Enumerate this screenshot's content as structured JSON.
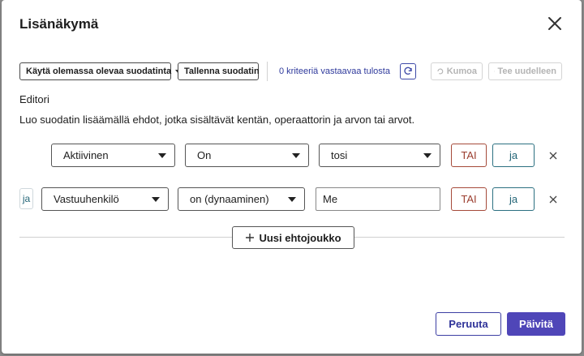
{
  "dialog": {
    "title": "Lisänäkymä",
    "close_icon": "close-icon"
  },
  "toolbar": {
    "use_filter_label": "Käytä olemassa olevaa suodatinta",
    "save_filter_label": "Tallenna suodatin",
    "match_count_text": "0 kriteeriä vastaavaa tulosta",
    "refresh_icon": "refresh-icon",
    "undo_label": "Kumoa",
    "redo_label": "Tee uudelleen"
  },
  "editor": {
    "label": "Editori",
    "instructions": "Luo suodatin lisäämällä ehdot, jotka sisältävät kentän, operaattorin ja arvon tai arvot."
  },
  "conditions": [
    {
      "join": "",
      "field": "Aktiivinen",
      "operator": "On",
      "value": "tosi",
      "value_type": "select",
      "or_label": "TAI",
      "and_label": "ja"
    },
    {
      "join": "ja",
      "field": "Vastuuhenkilö",
      "operator": "on (dynaaminen)",
      "value": "Me",
      "value_type": "input",
      "or_label": "TAI",
      "and_label": "ja"
    }
  ],
  "new_group_label": "Uusi ehtojoukko",
  "footer": {
    "cancel_label": "Peruuta",
    "update_label": "Päivitä"
  },
  "colors": {
    "primary": "#4f46b8",
    "link": "#2f3a9c",
    "or_button": "#9b3d2e",
    "and_button": "#236577"
  }
}
